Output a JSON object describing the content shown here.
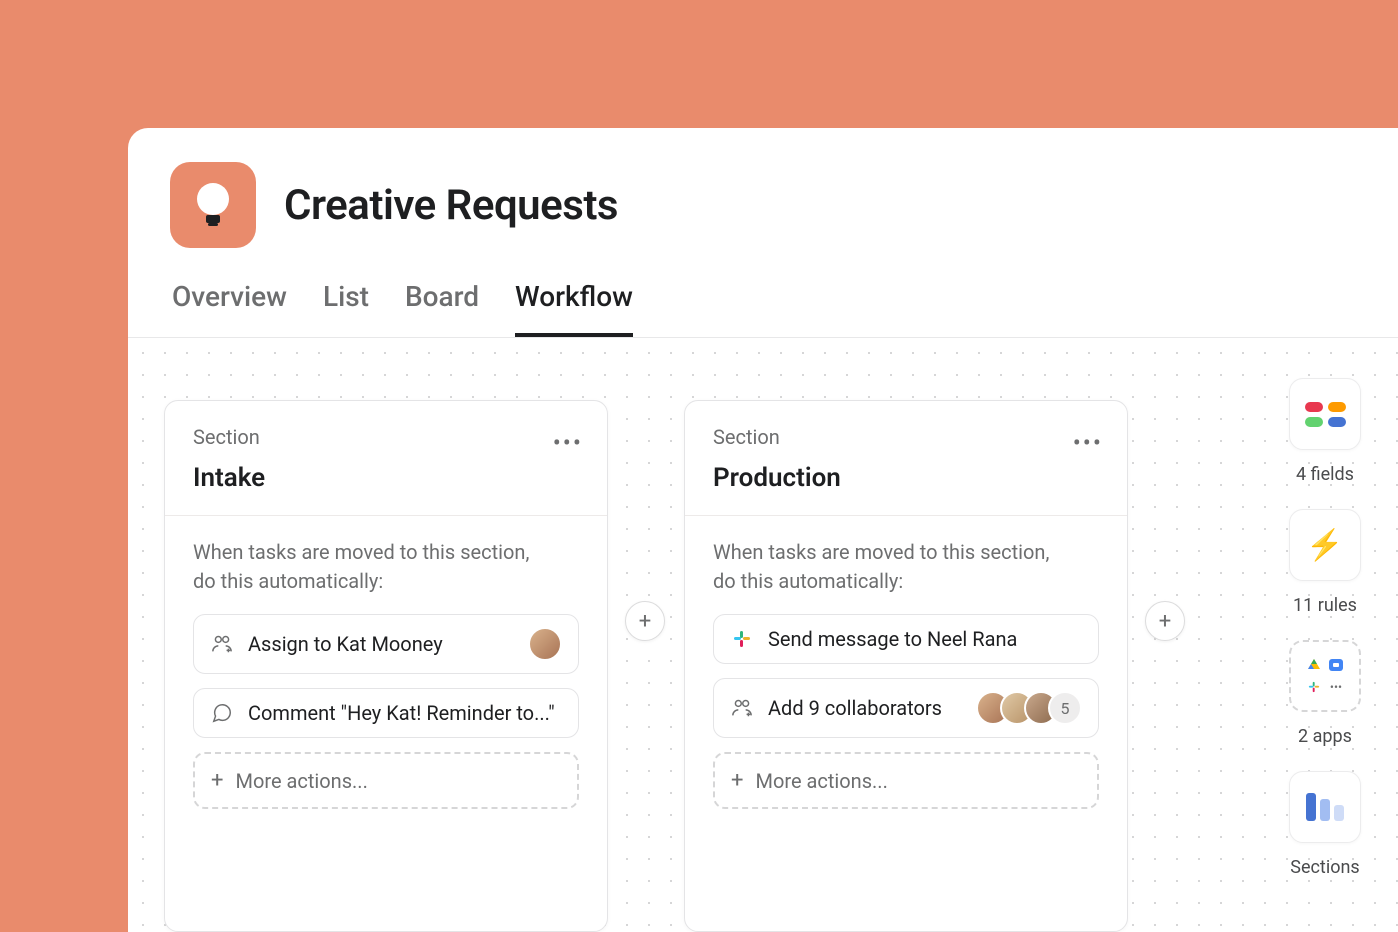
{
  "project": {
    "title": "Creative Requests"
  },
  "tabs": {
    "overview": "Overview",
    "list": "List",
    "board": "Board",
    "workflow": "Workflow"
  },
  "sections": [
    {
      "label": "Section",
      "title": "Intake",
      "desc_line1": "When tasks are moved to this section,",
      "desc_line2": "do this automatically:",
      "actions": {
        "assign": "Assign to Kat Mooney",
        "comment": "Comment \"Hey Kat! Reminder to...\""
      },
      "more": "More actions..."
    },
    {
      "label": "Section",
      "title": "Production",
      "desc_line1": "When tasks are moved to this section,",
      "desc_line2": "do this automatically:",
      "actions": {
        "message": "Send message to Neel Rana",
        "collab": "Add 9 collaborators",
        "collab_extra": "5"
      },
      "more": "More actions..."
    }
  ],
  "right_panel": {
    "fields": "4 fields",
    "rules": "11 rules",
    "apps": "2 apps",
    "sections": "Sections"
  }
}
